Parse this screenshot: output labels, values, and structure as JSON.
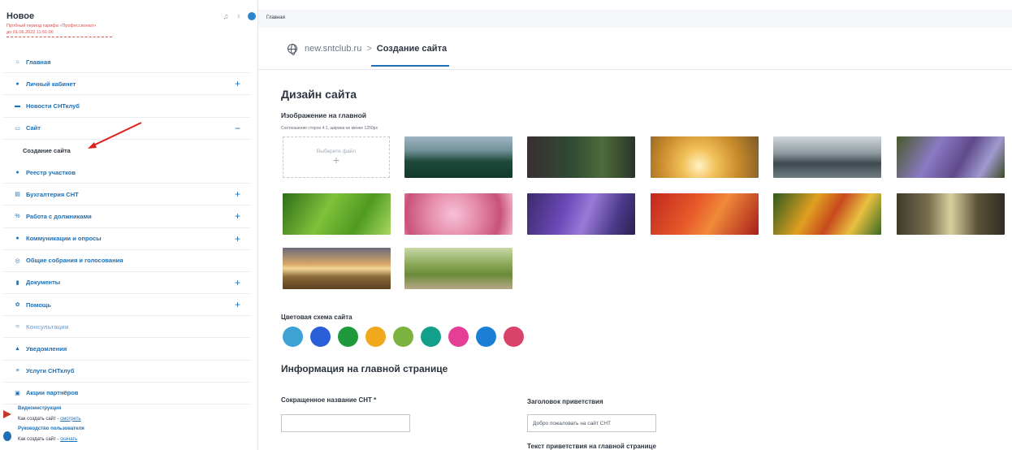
{
  "sidebar": {
    "title": "Новое",
    "trial_text": "Пробный период тарифа «Профессионал»",
    "trial_until": "до 01.06.2022 11:51:06",
    "items": [
      {
        "icon": "home-icon",
        "glyph": "⌂",
        "label": "Главная",
        "plus": ""
      },
      {
        "icon": "user-icon",
        "glyph": "●",
        "label": "Личный кабинет",
        "plus": "+"
      },
      {
        "icon": "news-icon",
        "glyph": "▬",
        "label": "Новости СНТклуб",
        "plus": ""
      },
      {
        "icon": "monitor-icon",
        "glyph": "▭",
        "label": "Сайт",
        "plus": "−"
      },
      {
        "icon": "",
        "glyph": "",
        "label": "Создание сайта",
        "plus": ""
      },
      {
        "icon": "members-icon",
        "glyph": "●",
        "label": "Реестр участков",
        "plus": ""
      },
      {
        "icon": "accounting-icon",
        "glyph": "▤",
        "label": "Бухгалтерия СНТ",
        "plus": "+"
      },
      {
        "icon": "percent-icon",
        "glyph": "%",
        "label": "Работа с должниками",
        "plus": "+"
      },
      {
        "icon": "chat-icon",
        "glyph": "●",
        "label": "Коммуникации и опросы",
        "plus": "+"
      },
      {
        "icon": "vote-icon",
        "glyph": "◎",
        "label": "Общие собрания и голосования",
        "plus": ""
      },
      {
        "icon": "document-icon",
        "glyph": "▮",
        "label": "Документы",
        "plus": "+"
      },
      {
        "icon": "help-icon",
        "glyph": "✿",
        "label": "Помощь",
        "plus": "+"
      },
      {
        "icon": "consult-icon",
        "glyph": "≋",
        "label": "Консультации",
        "plus": ""
      },
      {
        "icon": "bell-icon",
        "glyph": "▲",
        "label": "Уведомления",
        "plus": ""
      },
      {
        "icon": "services-icon",
        "glyph": "≡",
        "label": "Услуги СНТклуб",
        "plus": ""
      },
      {
        "icon": "gift-icon",
        "glyph": "▣",
        "label": "Акции партнёров",
        "plus": ""
      }
    ],
    "help": {
      "video_title": "Видеоинструкция",
      "video_text": "Как создать сайт - ",
      "video_link": "смотреть",
      "guide_title": "Руководство пользователя",
      "guide_text": "Как создать сайт - ",
      "guide_link": "скачать"
    }
  },
  "header": {
    "breadcrumb": "Главная"
  },
  "tabs": {
    "domain": "new.sntclub.ru",
    "separator": ">",
    "current": "Создание сайта"
  },
  "main": {
    "title": "Дизайн сайта",
    "image_heading": "Изображение на главной",
    "image_hint": "Соотношение сторон 4:1, ширина не менее 1250px",
    "file_label": "Выберите файл",
    "file_plus": "+",
    "images": [
      "mountain-forest-lake",
      "dark-forest",
      "sunrise-silhouette",
      "foggy-lake",
      "purple-flowers",
      "green-leaves",
      "pink-dahlia",
      "purple-crocuses",
      "red-autumn-leaves",
      "autumn-leaves",
      "pine-forest",
      "field-sunset",
      "tree-lined-road"
    ],
    "color_scheme_label": "Цветовая схема сайта",
    "colors": [
      "#3fa2d4",
      "#2b5fd9",
      "#1e9a3c",
      "#f0a81c",
      "#7cb340",
      "#13a08a",
      "#e53e95",
      "#1c7fd6",
      "#d9436a"
    ],
    "info_title": "Информация на главной странице",
    "short_name_label": "Сокращенное название СНТ *",
    "short_name_value": "",
    "greeting_label": "Заголовок приветствия",
    "greeting_value": "Добро пожаловать на сайт СНТ",
    "greeting_text_label": "Текст приветствия на главной странице"
  }
}
